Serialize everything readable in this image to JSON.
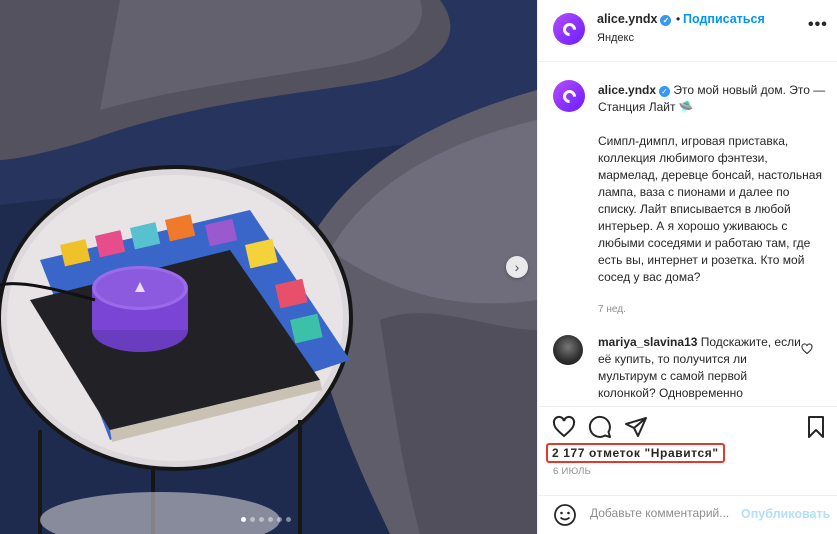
{
  "post": {
    "username": "alice.yndx",
    "follow_label": "Подписаться",
    "separator": "•",
    "location": "Яндекс",
    "more_label": "•••",
    "verified_mark": "✓"
  },
  "caption": {
    "username": "alice.yndx",
    "text": " Это мой новый дом. Это — Станция Лайт 🛸\n\nСимпл-димпл, игровая приставка, коллекция любимого фэнтези, мармелад, деревце бонсай, настольная лампа, ваза с пионами и далее по списку. Лайт вписывается в любой интерьер. А я хорошо уживаюсь с любыми соседями и работаю там, где есть вы, интернет и розетка. Кто мой сосед у вас дома?",
    "time": "7 нед."
  },
  "comment": {
    "username": "mariya_slavina13",
    "text": " Подскажите, если её купить, то получится ли мультирум с самой первой колонкой? Одновременно"
  },
  "stats": {
    "likes": "2 177 отметок \"Нравится\"",
    "date": "6 ИЮЛЬ"
  },
  "add_comment": {
    "placeholder": "Добавьте комментарий...",
    "post_label": "Опубликовать"
  },
  "carousel": {
    "next_label": "›",
    "slide_count": 6,
    "active_slide": 1
  },
  "colors": {
    "accent": "#0095f6",
    "highlight_box": "#e03a2d",
    "brand_purple": "#8a3cff"
  },
  "icons": [
    "alice-logo-icon",
    "verified-icon",
    "more-icon",
    "heart-icon",
    "comment-icon",
    "share-icon",
    "bookmark-icon",
    "emoji-icon",
    "next-arrow-icon"
  ]
}
